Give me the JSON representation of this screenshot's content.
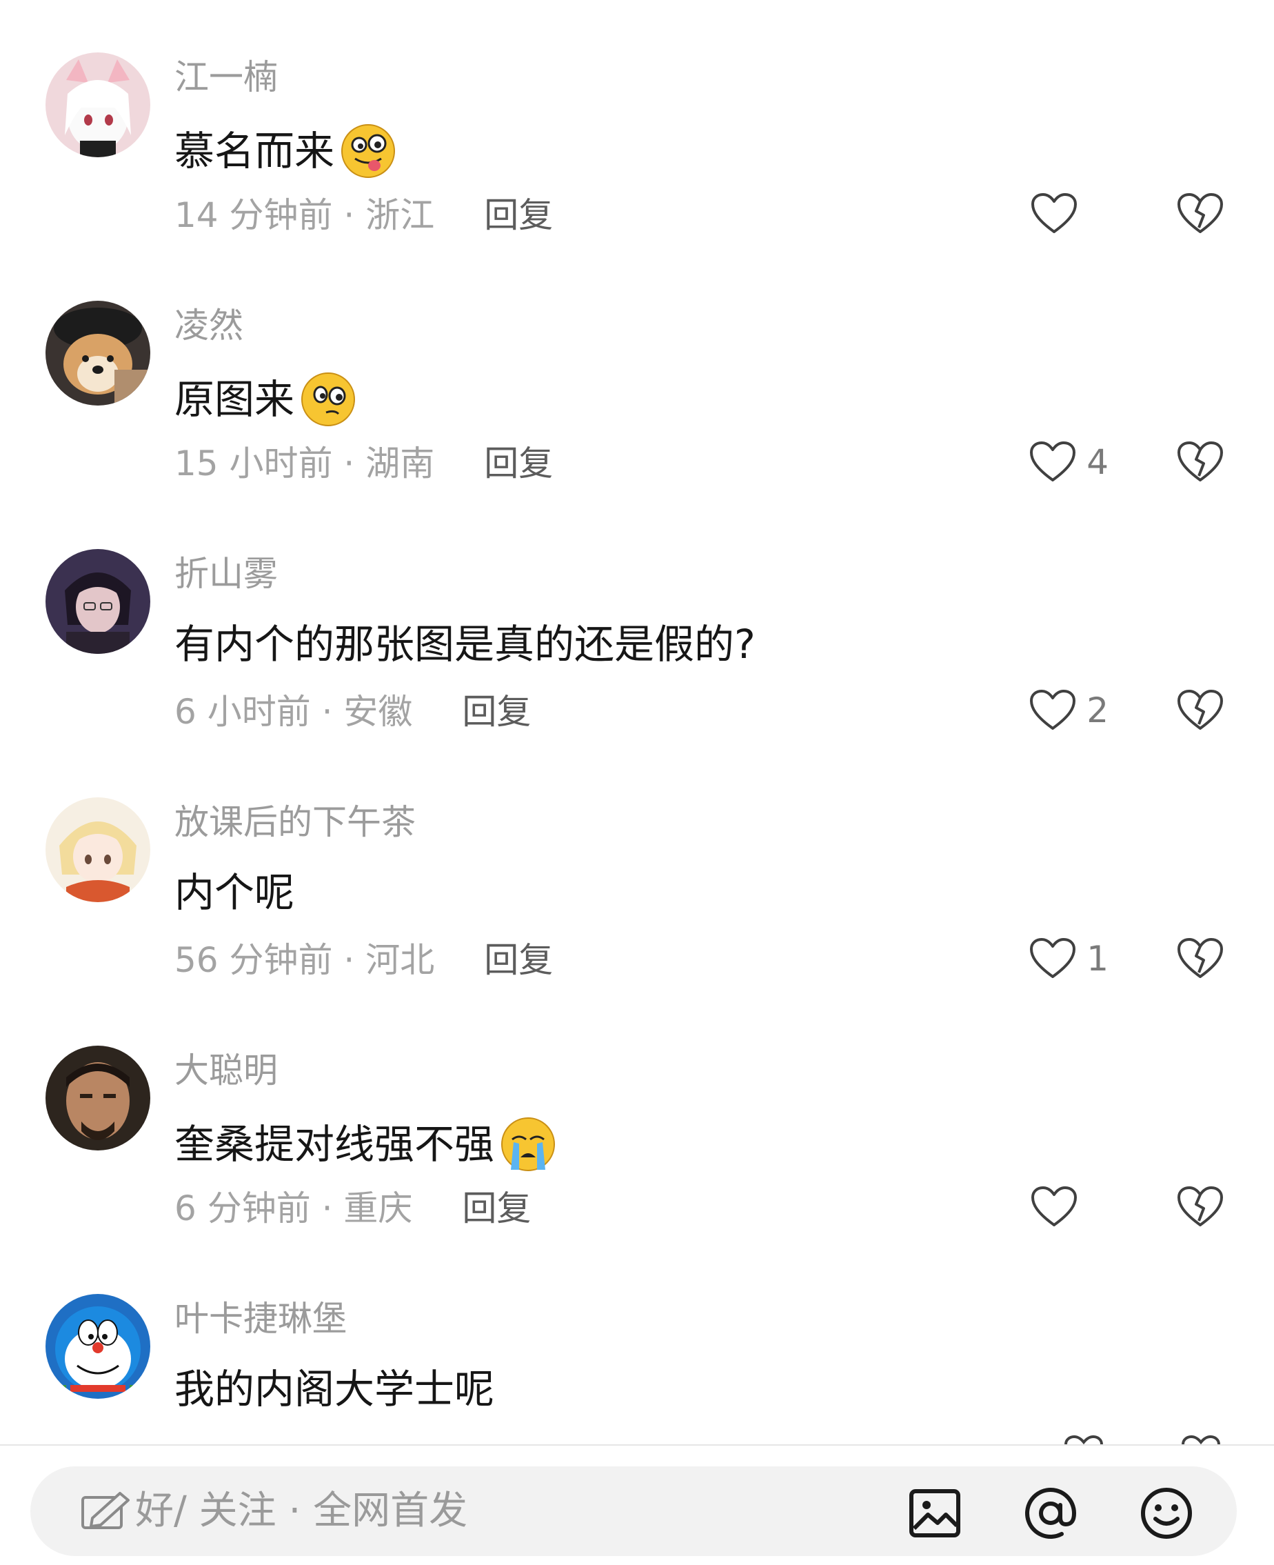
{
  "comments": [
    {
      "username": "江一楠",
      "text": "慕名而来",
      "time": "14 分钟前",
      "location": "浙江",
      "reply": "回复",
      "likes": "",
      "emoji": "tongue-emoji",
      "avatar": "anime-girl-white-hair"
    },
    {
      "username": "凌然",
      "text": "原图来",
      "time": "15 小时前",
      "location": "湖南",
      "reply": "回复",
      "likes": "4",
      "emoji": "smirk-emoji",
      "avatar": "shiba-dog"
    },
    {
      "username": "折山雾",
      "text": "有内个的那张图是真的还是假的?",
      "time": "6 小时前",
      "location": "安徽",
      "reply": "回复",
      "likes": "2",
      "emoji": "",
      "avatar": "anime-man-dark"
    },
    {
      "username": "放课后的下午茶",
      "text": "内个呢",
      "time": "56 分钟前",
      "location": "河北",
      "reply": "回复",
      "likes": "1",
      "emoji": "",
      "avatar": "anime-girl-blonde"
    },
    {
      "username": "大聪明",
      "text": "奎桑提对线强不强",
      "time": "6 分钟前",
      "location": "重庆",
      "reply": "回复",
      "likes": "",
      "emoji": "crying-emoji",
      "avatar": "man-portrait"
    },
    {
      "username": "叶卡捷琳堡",
      "text": "我的内阁大学士呢",
      "time": "",
      "location": "",
      "reply": "",
      "likes": "",
      "emoji": "",
      "avatar": "doraemon"
    }
  ],
  "input": {
    "placeholder": "好/ 关注 · 全网首发"
  },
  "icons": {
    "image": "image-icon",
    "mention": "at-icon",
    "emoji": "emoji-icon"
  },
  "colors": {
    "background": "#ffffff",
    "username": "#9b9b9b",
    "text": "#161616",
    "meta": "#a3a3a3",
    "icon": "#404040",
    "emoji": "#f7c531"
  }
}
